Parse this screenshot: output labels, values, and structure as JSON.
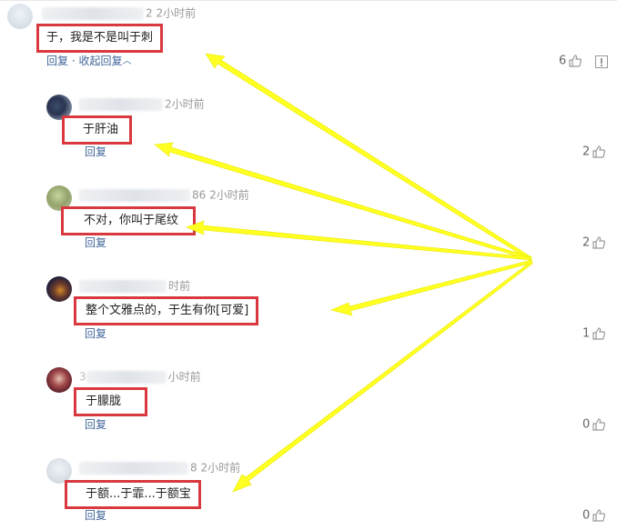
{
  "comments": [
    {
      "id": "c1",
      "meta_suffix": "2 2小时前",
      "text": "于，我是不是叫于刺",
      "reply_label": "回复",
      "collapse_label": "· 收起回复",
      "likes": "6"
    },
    {
      "id": "c2",
      "meta_suffix": "2小时前",
      "text": "于肝油",
      "reply_label": "回复",
      "likes": "2"
    },
    {
      "id": "c3",
      "meta_suffix": "86 2小时前",
      "text": "不对，你叫于尾纹",
      "reply_label": "回复",
      "likes": "2"
    },
    {
      "id": "c4",
      "meta_suffix": "时前",
      "text": "整个文雅点的，于生有你[可爱]",
      "reply_label": "回复",
      "likes": "1"
    },
    {
      "id": "c5",
      "meta_prefix": "3",
      "meta_suffix": "小时前",
      "text": "于朦胧",
      "reply_label": "回复",
      "likes": "0"
    },
    {
      "id": "c6",
      "meta_suffix": "8 2小时前",
      "text": "于额...于霏...于额宝",
      "reply_label": "回复",
      "likes": "0"
    }
  ],
  "annotation": {
    "highlight_color": "#d9383f",
    "arrow_color": "#ffff22"
  },
  "icons": {
    "like": "thumbs-up-icon",
    "report": "report-icon"
  },
  "colors": {
    "link": "#406599",
    "meta": "#999999",
    "text": "#222222"
  }
}
